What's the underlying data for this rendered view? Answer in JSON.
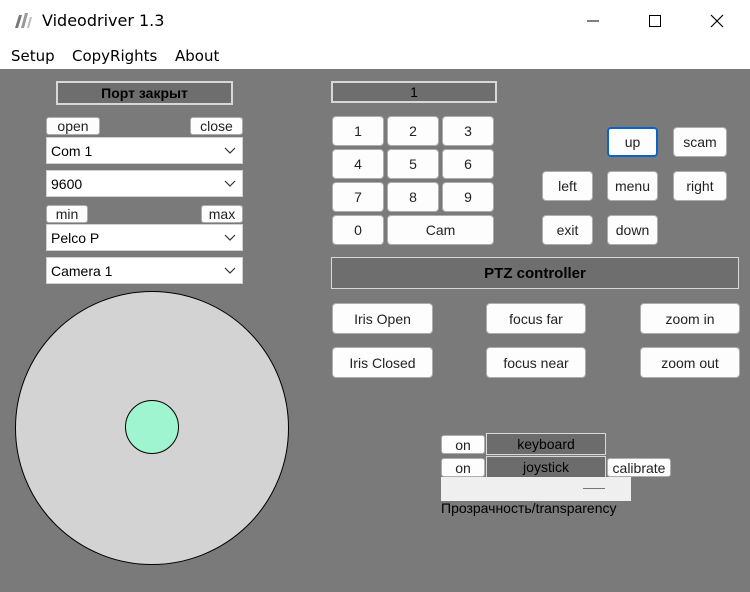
{
  "window": {
    "title": "Videodriver 1.3"
  },
  "menu": {
    "setup": "Setup",
    "copyrights": "CopyRights",
    "about": "About"
  },
  "port": {
    "status": "Порт закрыт",
    "open_label": "open",
    "close_label": "close",
    "com_value": "Com 1",
    "baud_value": "9600",
    "min_label": "min",
    "max_label": "max",
    "protocol_value": "Pelco P",
    "camera_value": "Camera 1"
  },
  "keypad": {
    "display": "1",
    "keys": [
      "1",
      "2",
      "3",
      "4",
      "5",
      "6",
      "7",
      "8",
      "9",
      "0"
    ],
    "cam_label": "Cam"
  },
  "nav": {
    "up": "up",
    "scam": "scam",
    "left": "left",
    "menu": "menu",
    "right": "right",
    "exit": "exit",
    "down": "down"
  },
  "ptz": {
    "title": "PTZ controller",
    "iris_open": "Iris Open",
    "focus_far": "focus far",
    "zoom_in": "zoom in",
    "iris_closed": "Iris Closed",
    "focus_near": "focus near",
    "zoom_out": "zoom out"
  },
  "input_mode": {
    "keyboard_on": "on",
    "keyboard_label": "keyboard",
    "joystick_on": "on",
    "joystick_label": "joystick",
    "calibrate_label": "calibrate"
  },
  "transparency": {
    "label": "Прозрачность/transparency"
  },
  "colors": {
    "client_bg": "#7a7a7a",
    "joystick_bg": "#d3d3d3",
    "joystick_knob": "#9ff5cf",
    "focus_border": "#0a64c8"
  }
}
